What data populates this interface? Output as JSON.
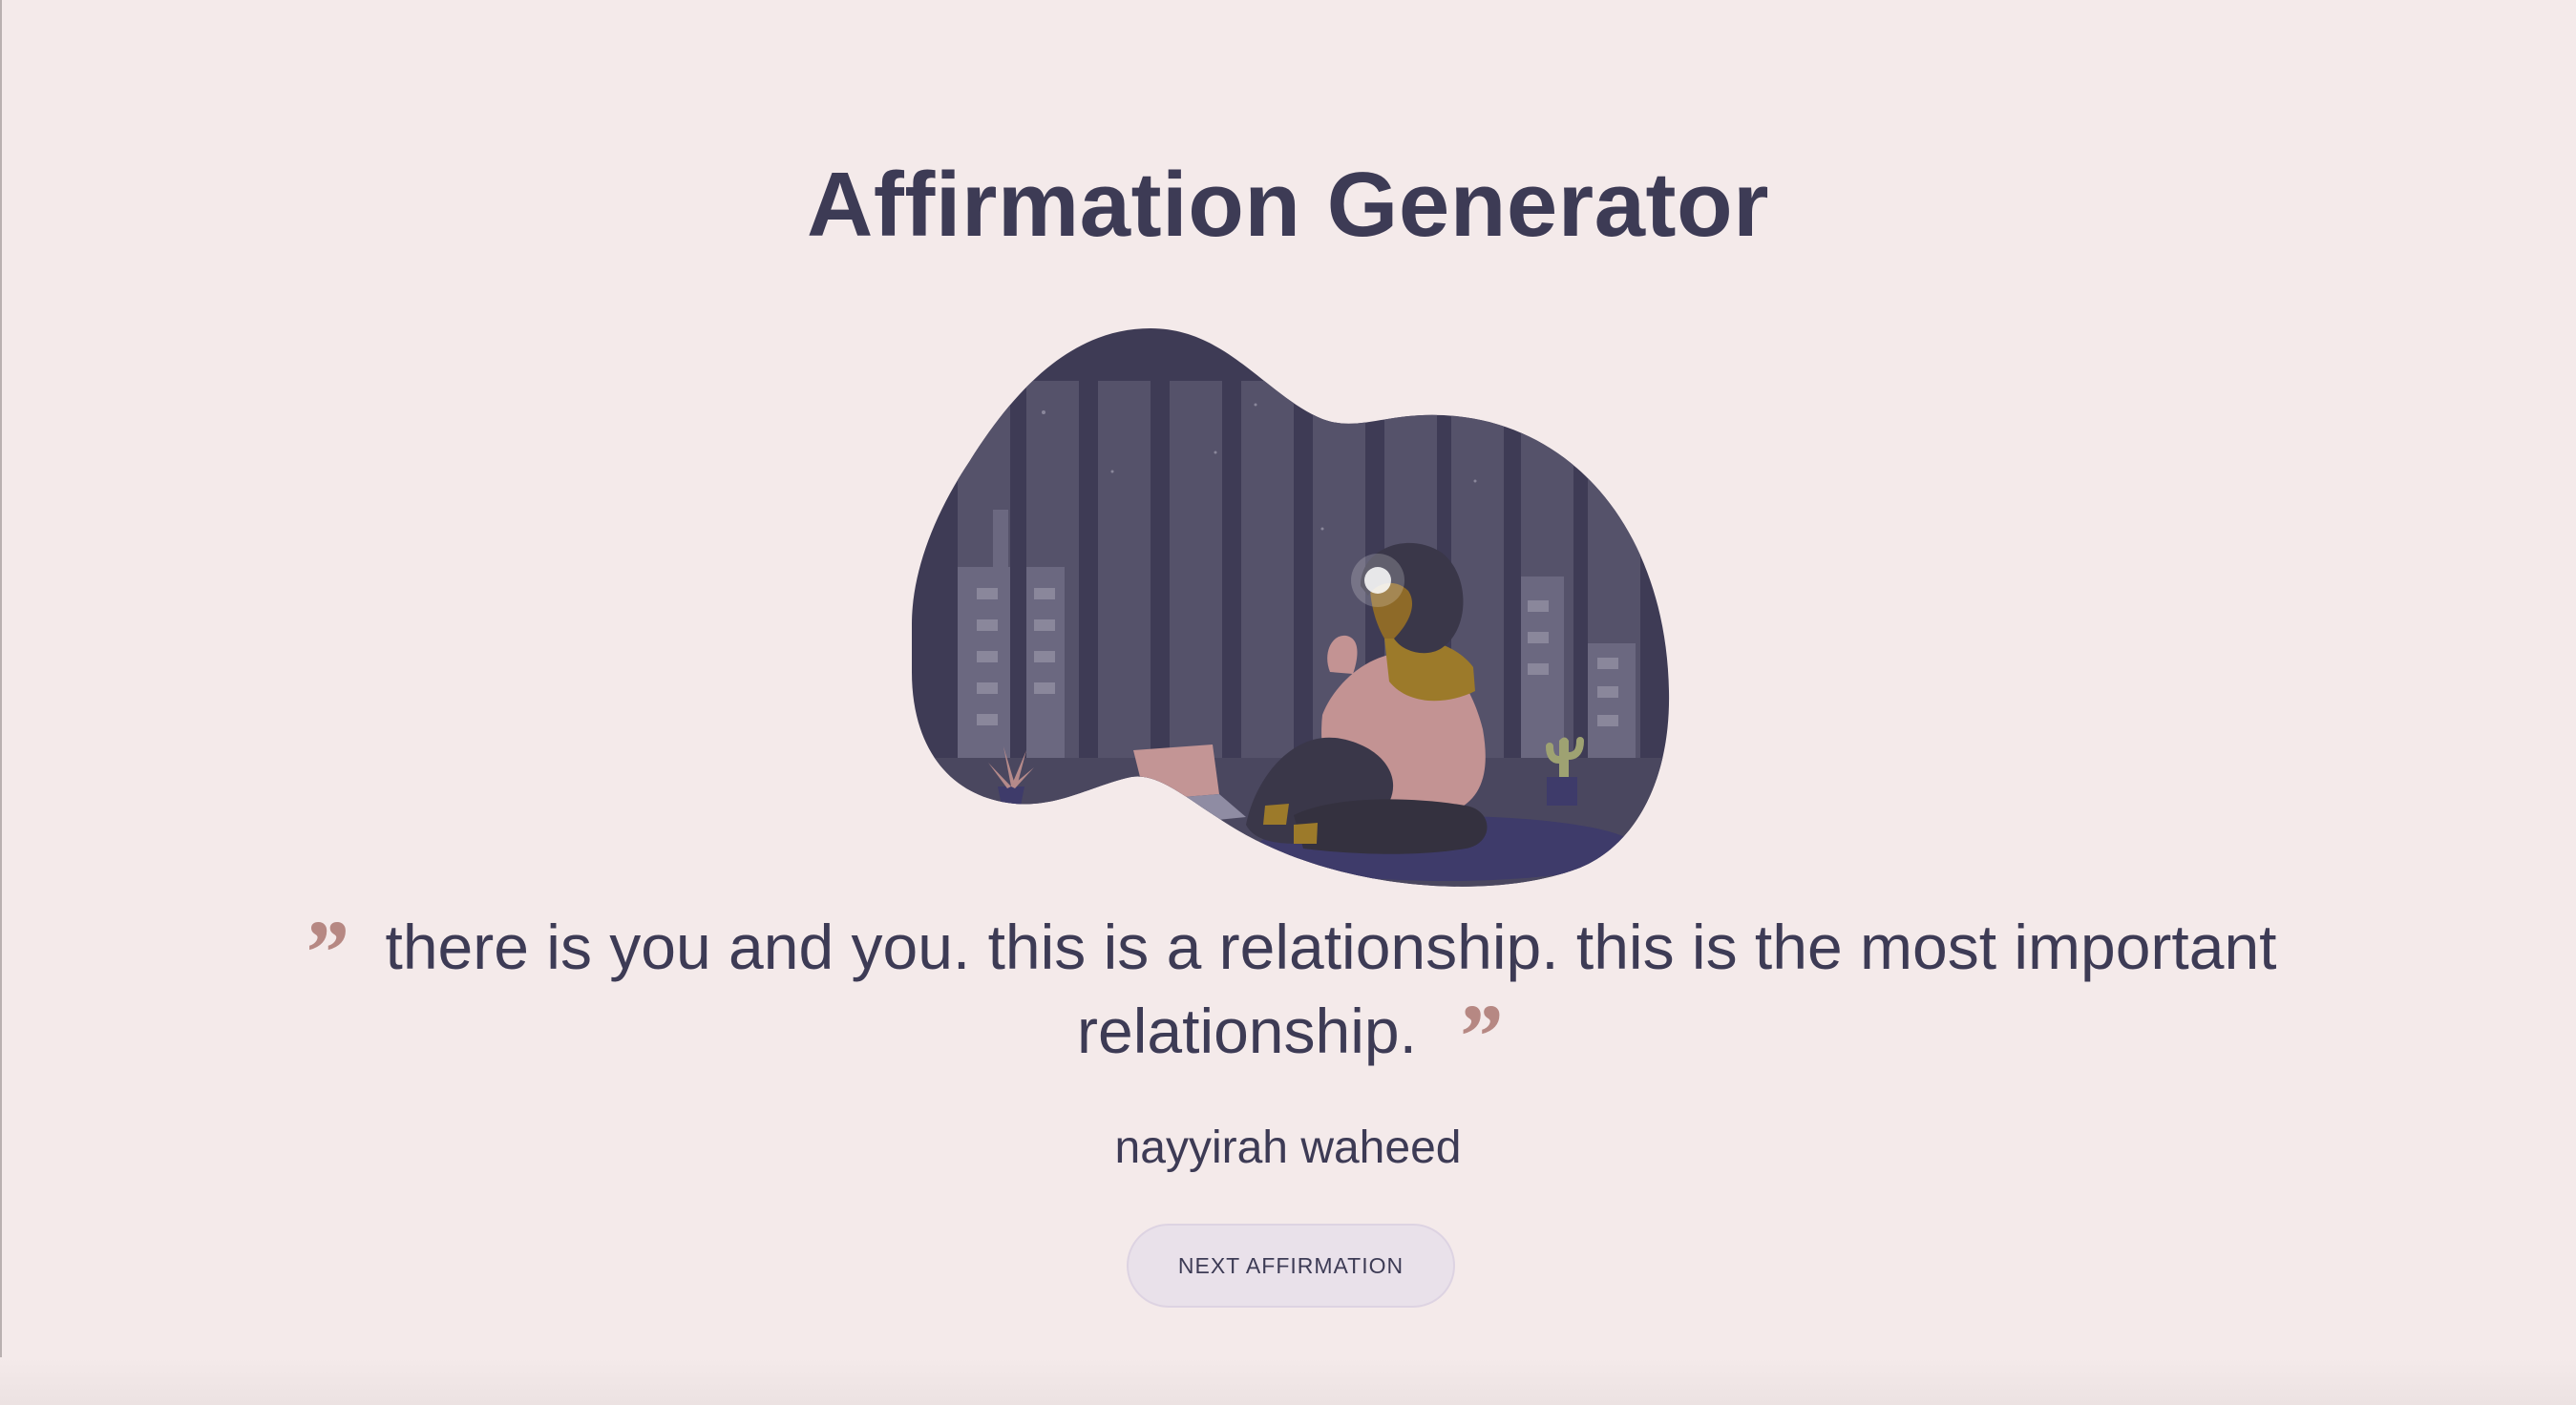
{
  "page": {
    "title": "Affirmation Generator"
  },
  "illustration": {
    "name": "woman-on-phone-at-night-illustration"
  },
  "affirmation": {
    "open_quote": "”",
    "text": "there is you and you. this is a relationship. this is the most important relationship.",
    "close_quote": "”",
    "author": "nayyirah waheed"
  },
  "actions": {
    "next_label": "NEXT AFFIRMATION"
  },
  "colors": {
    "background": "#f4eaea",
    "text": "#3d3b55",
    "quote_mark": "#b68883",
    "button_bg": "#e9e1ea"
  }
}
